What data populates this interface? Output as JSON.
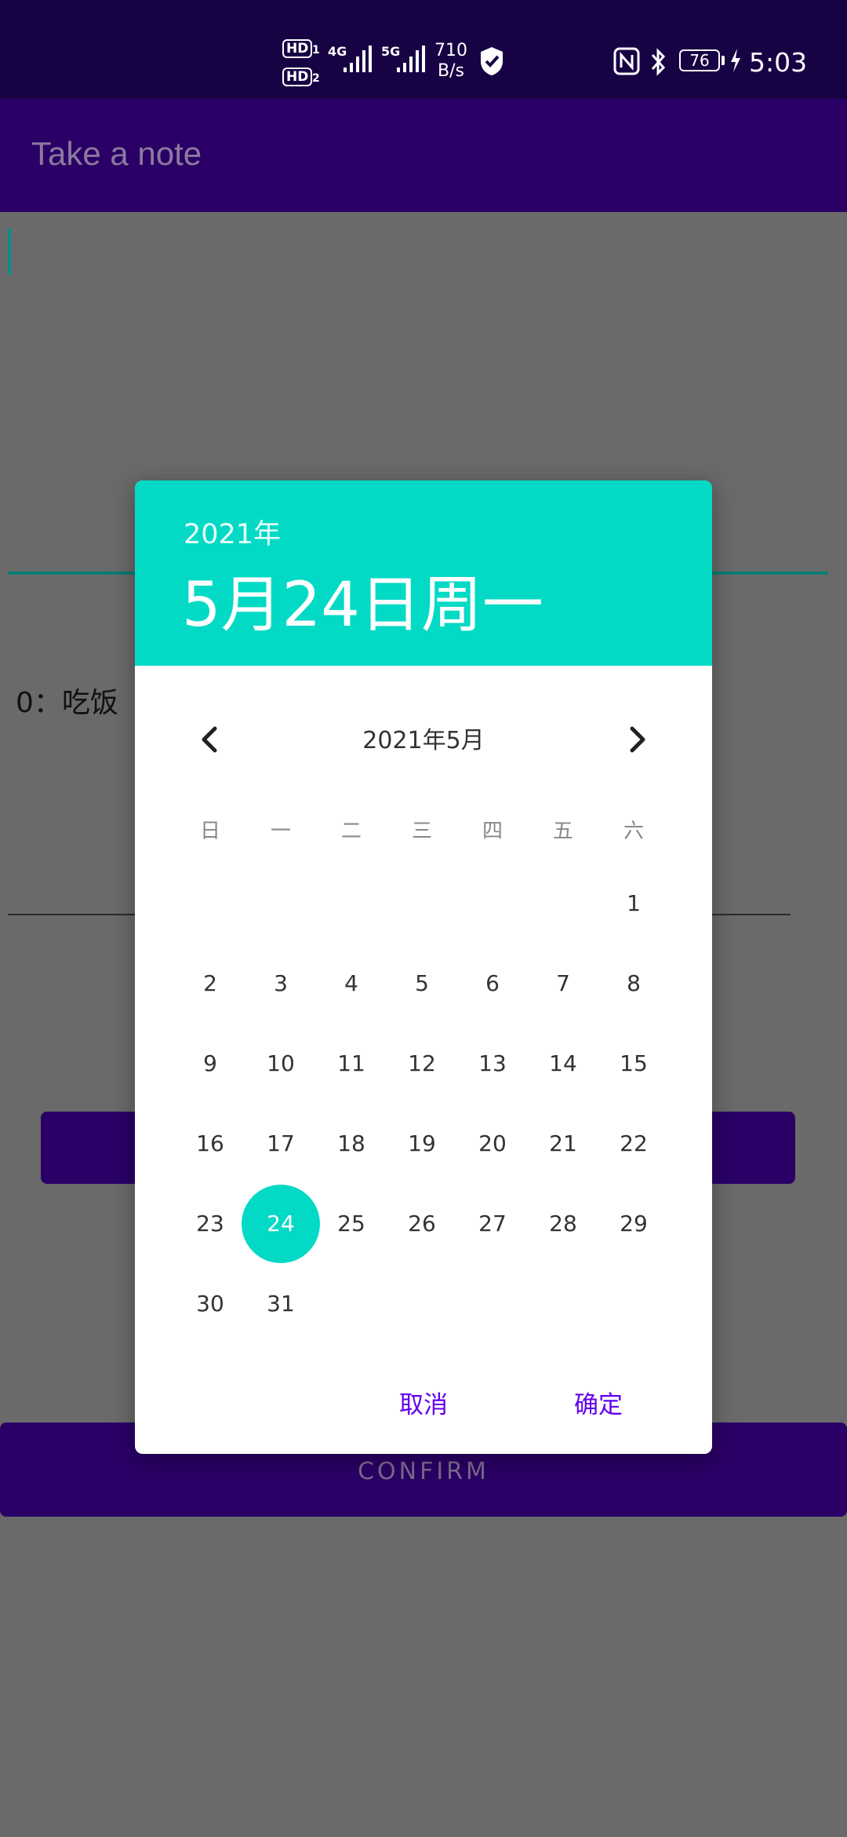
{
  "status_bar": {
    "hd1": "HD",
    "hd1_sub": "1",
    "hd2": "HD",
    "hd2_sub": "2",
    "net1": "4G",
    "net2": "5G",
    "speed_value": "710",
    "speed_unit": "B/s",
    "battery": "76",
    "time": "5:03"
  },
  "toolbar": {
    "title": "Take a note"
  },
  "form": {
    "item_label": "0：吃饭",
    "confirm_label": "CONFIRM"
  },
  "dialog": {
    "year": "2021年",
    "selected_date": "5月24日周一",
    "month_label": "2021年5月",
    "weekdays": [
      "日",
      "一",
      "二",
      "三",
      "四",
      "五",
      "六"
    ],
    "selected_day": 24,
    "days_in_month": 31,
    "first_weekday_index": 6,
    "cancel_label": "取消",
    "ok_label": "确定"
  },
  "colors": {
    "accent": "#03dac5",
    "primary": "#2a0066",
    "button_text": "#6200ee",
    "scrim": "#6a6a6a"
  }
}
